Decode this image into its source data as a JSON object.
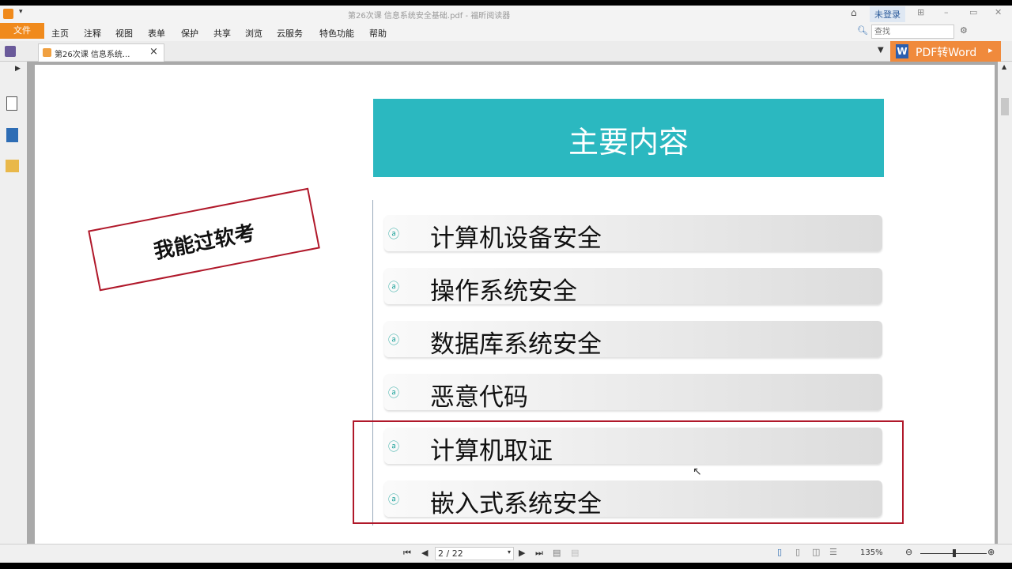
{
  "window": {
    "title": "第26次课 信息系统安全基础.pdf - 福昕阅读器",
    "login": "未登录"
  },
  "menu": {
    "file": "文件",
    "items": [
      "主页",
      "注释",
      "视图",
      "表单",
      "保护",
      "共享",
      "浏览",
      "云服务",
      "特色功能",
      "帮助"
    ]
  },
  "search": {
    "placeholder": "查找"
  },
  "tab": {
    "label": "第26次课 信息系统...",
    "close": "×"
  },
  "promo": {
    "label": "PDF转Word",
    "arrow": "▸"
  },
  "slide": {
    "title": "主要内容",
    "stamp": "我能过软考",
    "items": [
      "计算机设备安全",
      "操作系统安全",
      "数据库系统安全",
      "恶意代码",
      "计算机取证",
      "嵌入式系统安全"
    ],
    "bullet": "ⓐ"
  },
  "status": {
    "page": "2 / 22",
    "zoom": "135%"
  },
  "colors": {
    "accent": "#f08a1c",
    "teal": "#2bb8c0",
    "highlight": "#b0182a"
  }
}
